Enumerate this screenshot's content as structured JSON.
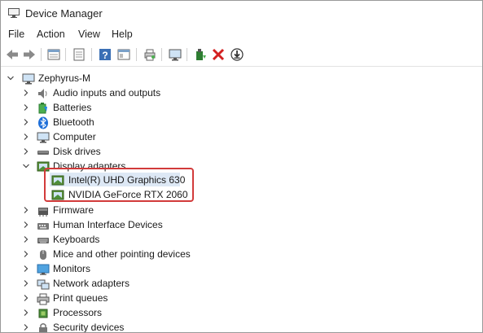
{
  "window": {
    "title": "Device Manager"
  },
  "menu": [
    "File",
    "Action",
    "View",
    "Help"
  ],
  "toolbar": {
    "icons": [
      "back-arrow-icon",
      "forward-arrow-icon",
      "properties-icon",
      "show-hidden-icon",
      "help-icon",
      "action-icon",
      "print-icon",
      "monitor-icon",
      "update-driver-icon",
      "uninstall-icon",
      "scan-download-icon"
    ]
  },
  "tree": {
    "root": "Zephyrus-M",
    "categories": [
      "Audio inputs and outputs",
      "Batteries",
      "Bluetooth",
      "Computer",
      "Disk drives",
      "Display adapters",
      "Firmware",
      "Human Interface Devices",
      "Keyboards",
      "Mice and other pointing devices",
      "Monitors",
      "Network adapters",
      "Print queues",
      "Processors",
      "Security devices"
    ],
    "display_children": [
      "Intel(R) UHD Graphics 630",
      "NVIDIA GeForce RTX 2060"
    ]
  },
  "colors": {
    "highlight": "#d23b3b",
    "selected": "#dde8f5"
  }
}
